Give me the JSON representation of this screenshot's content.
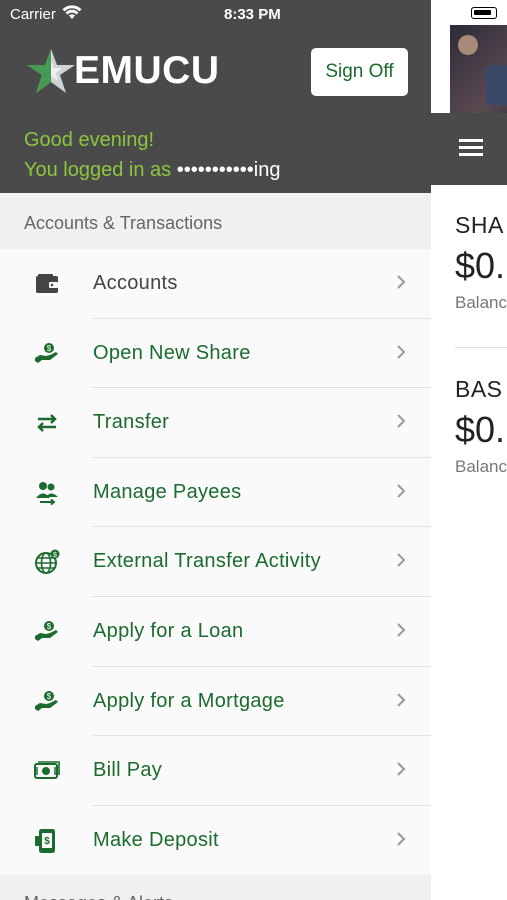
{
  "status_bar": {
    "carrier": "Carrier",
    "time": "8:33 PM"
  },
  "brand": {
    "name": "EMUCU",
    "accent_green": "#8cc63f",
    "menu_green": "#1b6b2e",
    "header_gray": "#4a4a4a"
  },
  "header": {
    "sign_off_label": "Sign Off",
    "greeting": "Good evening!",
    "login_prefix": "You logged in as",
    "masked_username": "•••••••••••ing"
  },
  "menu": {
    "section_title": "Accounts & Transactions",
    "items": [
      {
        "label": "Accounts",
        "icon": "wallet-icon"
      },
      {
        "label": "Open New Share",
        "icon": "hand-coin-icon"
      },
      {
        "label": "Transfer",
        "icon": "transfer-arrows-icon"
      },
      {
        "label": "Manage Payees",
        "icon": "payees-icon"
      },
      {
        "label": "External Transfer Activity",
        "icon": "globe-dollar-icon"
      },
      {
        "label": "Apply for a Loan",
        "icon": "hand-coin-icon"
      },
      {
        "label": "Apply for a Mortgage",
        "icon": "hand-coin-icon"
      },
      {
        "label": "Bill Pay",
        "icon": "cash-bill-icon"
      },
      {
        "label": "Make Deposit",
        "icon": "mobile-deposit-icon"
      }
    ],
    "next_section_partial": "Messages & Alerts"
  },
  "content": {
    "accounts": [
      {
        "name": "SHA",
        "amount": "$0.",
        "sub": "Balanc"
      },
      {
        "name": "BAS",
        "amount": "$0.",
        "sub": "Balanc"
      }
    ]
  }
}
